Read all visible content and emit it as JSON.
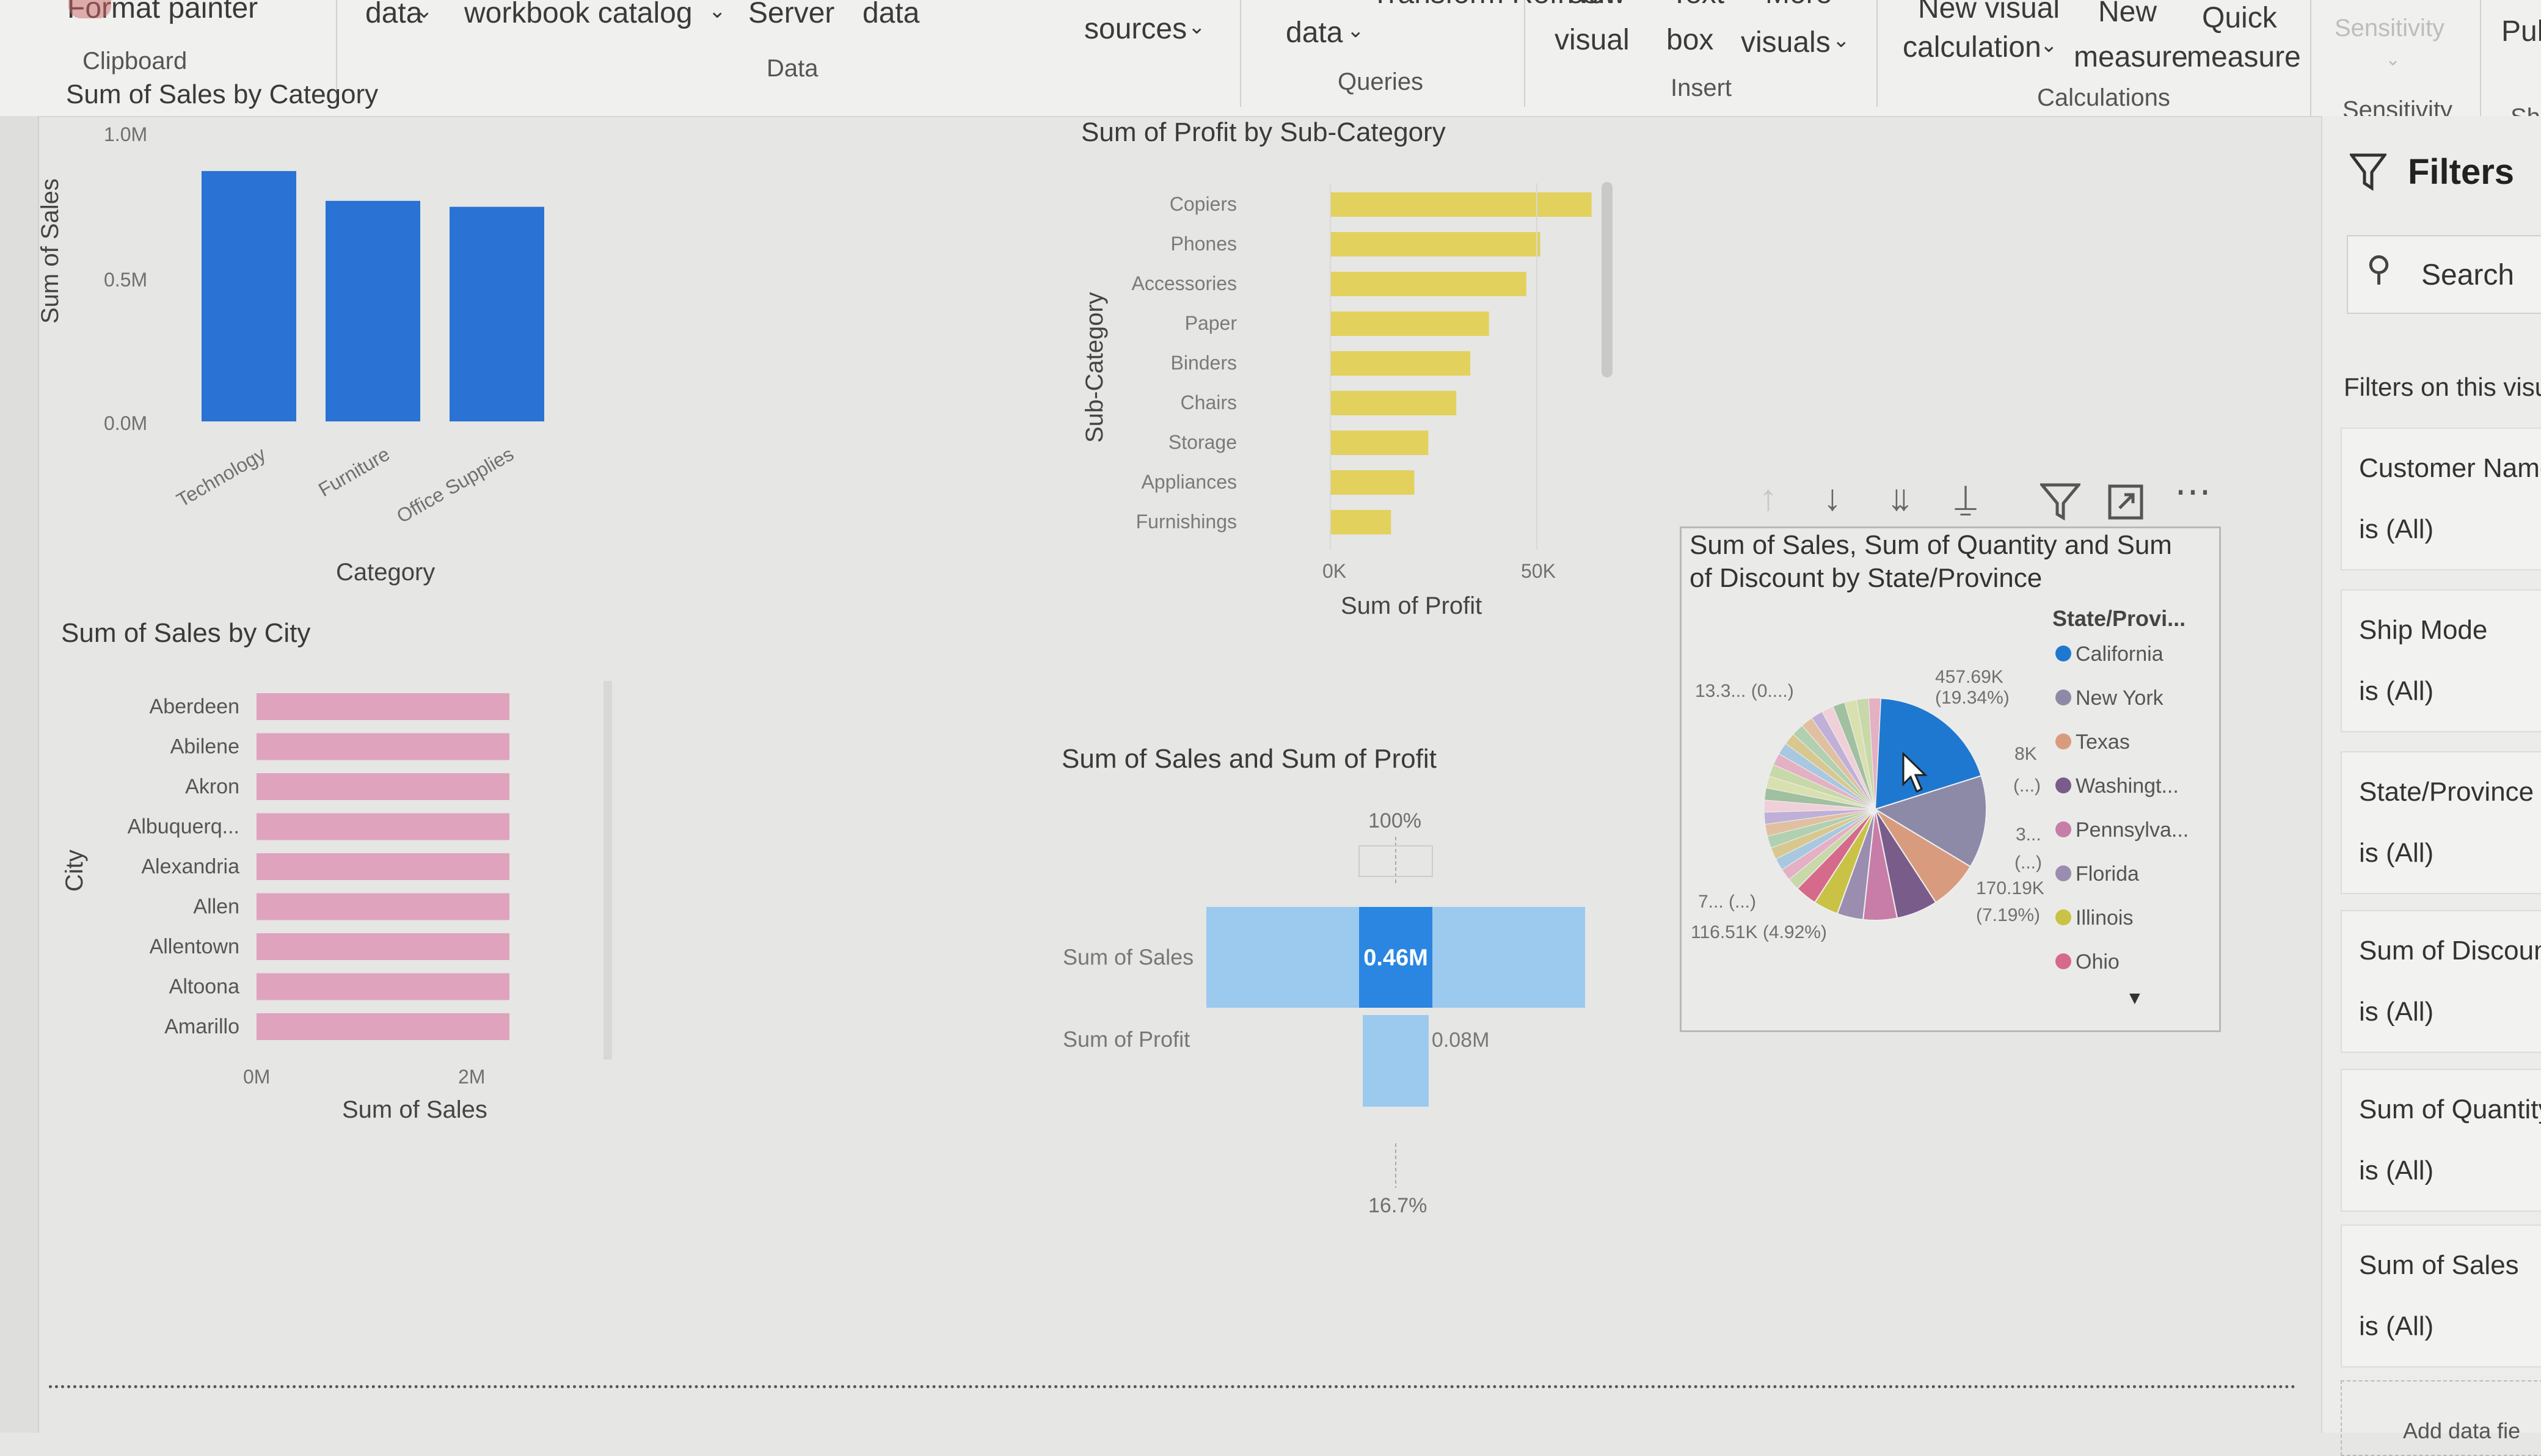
{
  "ribbon": {
    "clipboard": {
      "format_painter": "Format painter",
      "group": "Clipboard"
    },
    "data": {
      "get_data": "data",
      "excel": "workbook catalog",
      "sql": "Server",
      "enter": "data",
      "group": "Data"
    },
    "queries": {
      "recent": "sources",
      "transform": "data",
      "refresh_partial": "Transform Refresh",
      "group": "Queries"
    },
    "insert": {
      "new_visual_top": "New",
      "new_visual": "visual",
      "text_box_top": "Text",
      "text_box": "box",
      "more_visuals_top": "More",
      "more_visuals": "visuals",
      "group": "Insert"
    },
    "calculations": {
      "new_visual_calc_top": "New visual",
      "new_visual_calc": "calculation",
      "new_measure_top": "New",
      "new_measure": "measure",
      "quick_measure_top": "Quick",
      "quick_measure": "measure",
      "group": "Calculations"
    },
    "sensitivity": {
      "label": "Sensitivity",
      "group": "Sensitivity"
    },
    "share": {
      "label": "Pub",
      "group": "Sh"
    }
  },
  "charts": {
    "category": {
      "title": "Sum of Sales by Category",
      "xlabel": "Category",
      "ylabel": "Sum of Sales",
      "yticks": [
        "1.0M",
        "0.5M",
        "0.0M"
      ]
    },
    "subcategory": {
      "title": "Sum of Profit by Sub-Category",
      "xlabel": "Sum of Profit",
      "ylabel": "Sub-Category",
      "xticks": [
        "0K",
        "50K"
      ]
    },
    "city": {
      "title": "Sum of Sales by City",
      "xlabel": "Sum of Sales",
      "ylabel": "City",
      "xticks": [
        "0M",
        "2M"
      ]
    },
    "funnel": {
      "title": "Sum of Sales and Sum of Profit",
      "top_pct": "100%",
      "bottom_pct": "16.7%"
    },
    "pie": {
      "title_line1": "Sum of Sales, Sum of Quantity and Sum",
      "title_line2": "of Discount by State/Province",
      "legend_title": "State/Provi...",
      "labels": {
        "l1": "13.3... (0....)",
        "l2a": "457.69K",
        "l2b": "(19.34%)",
        "l3a": "8K",
        "l3b": "(...)",
        "l4a": "3...",
        "l4b": "(...)",
        "l5a": "170.19K",
        "l5b": "(7.19%)",
        "l6": "7... (...)",
        "l7": "116.51K (4.92%)"
      }
    }
  },
  "visual_toolbar": {
    "icons": [
      "arrow-up-icon",
      "arrow-down-icon",
      "double-arrow-down-icon",
      "expand-hierarchy-icon",
      "filter-icon",
      "focus-mode-icon",
      "more-options-icon"
    ]
  },
  "filters": {
    "title": "Filters",
    "search_placeholder": "Search",
    "section_label": "Filters on this visu",
    "cards": [
      {
        "name": "Customer Name",
        "value": "is (All)"
      },
      {
        "name": "Ship Mode",
        "value": "is (All)"
      },
      {
        "name": "State/Province",
        "value": "is (All)"
      },
      {
        "name": "Sum of Discount",
        "value": "is (All)"
      },
      {
        "name": "Sum of Quantity",
        "value": "is (All)"
      },
      {
        "name": "Sum of Sales",
        "value": "is (All)"
      }
    ],
    "add_data": "Add data fie"
  },
  "colors": {
    "blue": "#2a72d4",
    "gold": "#e1cc45",
    "pink": "#e0a3be",
    "light_blue": "#9cc9ee",
    "california": "#1f78d0"
  },
  "chart_data": [
    {
      "type": "bar",
      "title": "Sum of Sales by Category",
      "xlabel": "Category",
      "ylabel": "Sum of Sales",
      "categories": [
        "Technology",
        "Furniture",
        "Office Supplies"
      ],
      "values": [
        840000,
        740000,
        720000
      ],
      "ylim": [
        0,
        1000000
      ],
      "yticks": [
        "0.0M",
        "0.5M",
        "1.0M"
      ],
      "color": "#2a72d4"
    },
    {
      "type": "bar",
      "orientation": "horizontal",
      "title": "Sum of Profit by Sub-Category",
      "xlabel": "Sum of Profit",
      "ylabel": "Sub-Category",
      "categories": [
        "Copiers",
        "Phones",
        "Accessories",
        "Paper",
        "Binders",
        "Chairs",
        "Storage",
        "Appliances",
        "Furnishings"
      ],
      "values": [
        56000,
        45000,
        42000,
        34000,
        30000,
        27000,
        21000,
        18000,
        13000
      ],
      "xlim": [
        0,
        55000
      ],
      "xticks": [
        "0K",
        "50K"
      ],
      "color": "#e1cc45"
    },
    {
      "type": "bar",
      "orientation": "horizontal",
      "title": "Sum of Sales by City",
      "xlabel": "Sum of Sales",
      "ylabel": "City",
      "categories": [
        "Aberdeen",
        "Abilene",
        "Akron",
        "Albuquerq...",
        "Alexandria",
        "Allen",
        "Allentown",
        "Altoona",
        "Amarillo"
      ],
      "values": [
        2300000,
        2300000,
        2300000,
        2300000,
        2300000,
        2300000,
        2300000,
        2300000,
        2300000
      ],
      "xlim": [
        0,
        2500000
      ],
      "xticks": [
        "0M",
        "2M"
      ],
      "color": "#e0a3be"
    },
    {
      "type": "bar",
      "subtype": "funnel",
      "title": "Sum of Sales and Sum of Profit",
      "categories": [
        "Sum of Sales",
        "Sum of Profit"
      ],
      "values": [
        460000,
        80000
      ],
      "value_labels": [
        "0.46M",
        "0.08M"
      ],
      "percent_labels": [
        "100%",
        "16.7%"
      ]
    },
    {
      "type": "pie",
      "title": "Sum of Sales, Sum of Quantity and Sum of Discount by State/Province",
      "legend_title": "State/Provi...",
      "legend": [
        {
          "name": "California",
          "color": "#1f78d0"
        },
        {
          "name": "New York",
          "color": "#8d8aa8"
        },
        {
          "name": "Texas",
          "color": "#d99b7e"
        },
        {
          "name": "Washingt...",
          "color": "#7a5c8a"
        },
        {
          "name": "Pennsylva...",
          "color": "#c77da8"
        },
        {
          "name": "Florida",
          "color": "#9a8db0"
        },
        {
          "name": "Illinois",
          "color": "#c9c244"
        },
        {
          "name": "Ohio",
          "color": "#d66a8a"
        }
      ],
      "slices": [
        {
          "label": "California",
          "value": 19.34,
          "color": "#1f78d0"
        },
        {
          "label": "New York",
          "value": 13.5,
          "color": "#8d8aa8"
        },
        {
          "label": "Texas",
          "value": 7.19,
          "color": "#d99b7e"
        },
        {
          "label": "Washingt...",
          "value": 6.0,
          "color": "#7a5c8a"
        },
        {
          "label": "Pennsylva...",
          "value": 4.92,
          "color": "#c77da8"
        },
        {
          "label": "Florida",
          "value": 3.8,
          "color": "#9a8db0"
        },
        {
          "label": "Illinois",
          "value": 3.6,
          "color": "#c9c244"
        },
        {
          "label": "Ohio",
          "value": 3.2,
          "color": "#d66a8a"
        },
        {
          "label": "Others",
          "value": 38.45,
          "color": "#b8c4a0"
        }
      ]
    }
  ]
}
